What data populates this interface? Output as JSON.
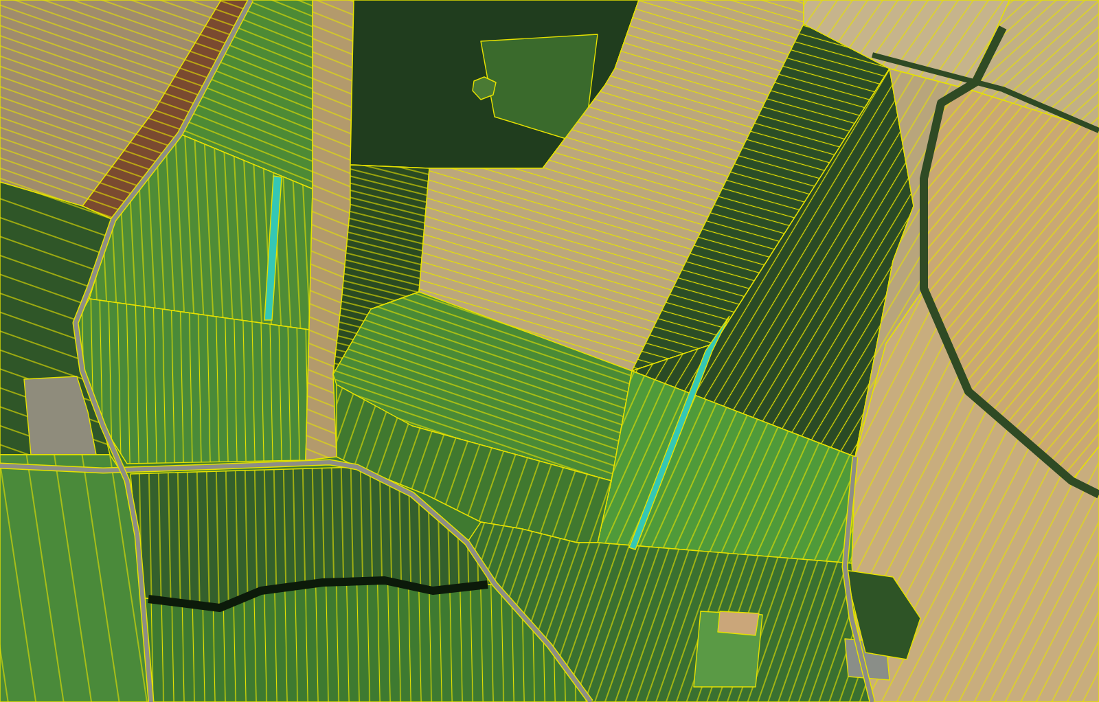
{
  "map": {
    "parcels": [
      {
        "highlighted": true
      },
      {
        "highlighted": true
      }
    ]
  }
}
